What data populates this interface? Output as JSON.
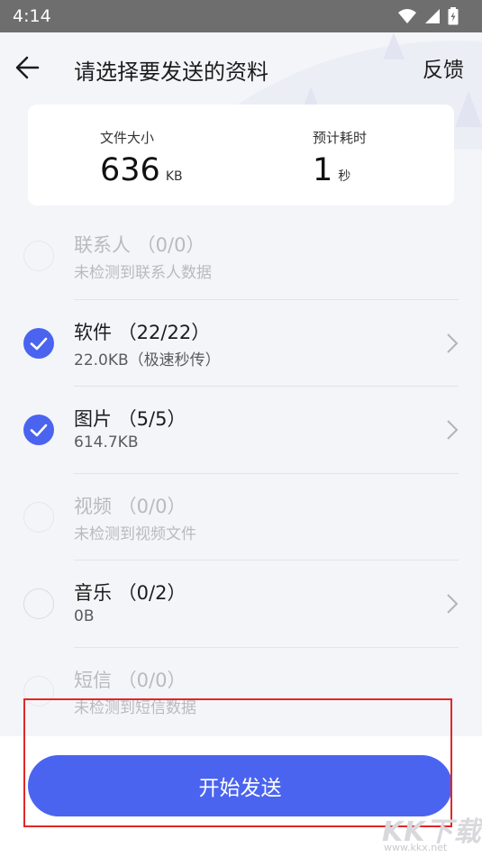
{
  "status_bar": {
    "time": "4:14"
  },
  "header": {
    "title": "请选择要发送的资料",
    "feedback_label": "反馈"
  },
  "summary": {
    "size_label": "文件大小",
    "size_value": "636",
    "size_unit": "KB",
    "time_label": "预计耗时",
    "time_value": "1",
    "time_unit": "秒"
  },
  "items": [
    {
      "name": "联系人 （0/0）",
      "detail": "未检测到联系人数据",
      "checked": false,
      "enabled": false
    },
    {
      "name": "软件 （22/22）",
      "detail": "22.0KB（极速秒传）",
      "checked": true,
      "enabled": true
    },
    {
      "name": "图片 （5/5）",
      "detail": "614.7KB",
      "checked": true,
      "enabled": true
    },
    {
      "name": "视频 （0/0）",
      "detail": "未检测到视频文件",
      "checked": false,
      "enabled": false
    },
    {
      "name": "音乐 （0/2）",
      "detail": "0B",
      "checked": false,
      "enabled": true
    },
    {
      "name": "短信 （0/0）",
      "detail": "未检测到短信数据",
      "checked": false,
      "enabled": false
    }
  ],
  "bottom": {
    "start_label": "开始发送"
  },
  "watermark": {
    "logo": "KK下载",
    "url": "www.kkx.net"
  },
  "colors": {
    "accent": "#4a64f0",
    "highlight": "#e02828"
  }
}
